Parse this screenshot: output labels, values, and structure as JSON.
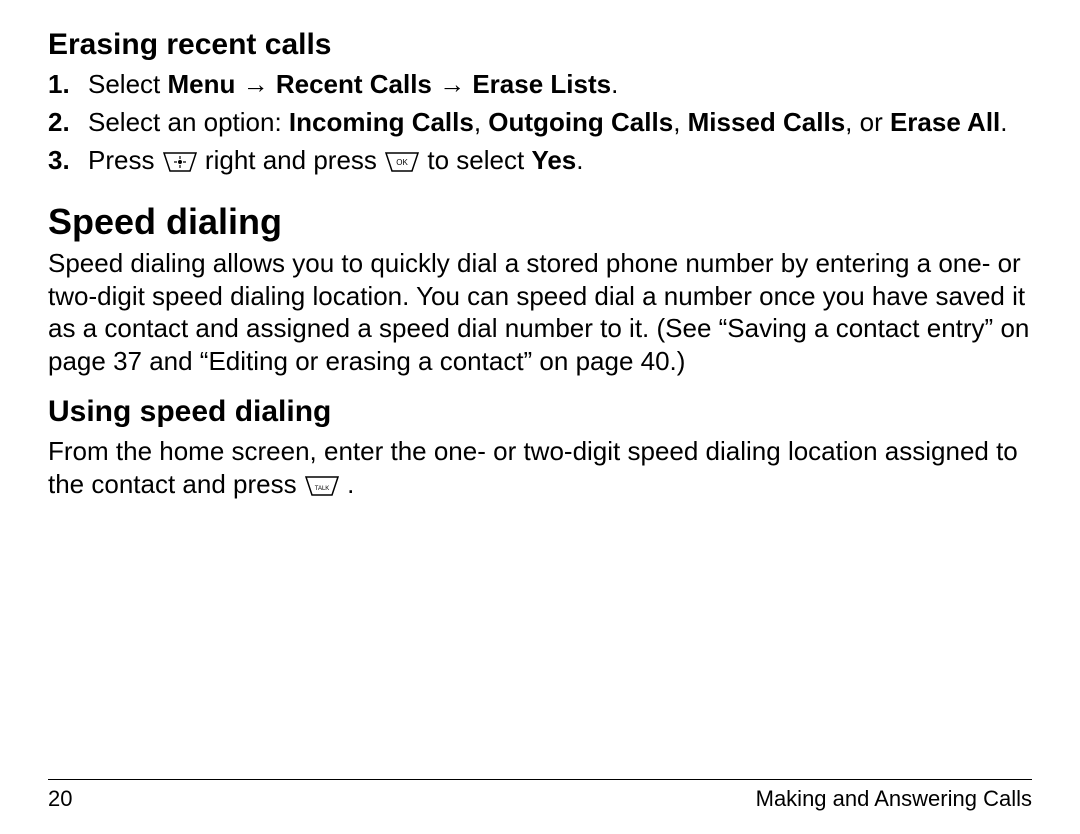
{
  "sections": {
    "erasing_heading": "Erasing recent calls",
    "step1": {
      "prefix": "Select ",
      "bold": "Menu → Recent Calls → Erase Lists",
      "suffix": "."
    },
    "step2": {
      "prefix": "Select an option: ",
      "b1": "Incoming Calls",
      "sep1": ", ",
      "b2": "Outgoing Calls",
      "sep2": ", ",
      "b3": "Missed Calls",
      "sep3": ", or ",
      "b4": "Erase All",
      "suffix": "."
    },
    "step3": {
      "prefix": "Press ",
      "mid": " right and press ",
      "after": " to select ",
      "yes": "Yes",
      "suffix": "."
    },
    "speed_heading": "Speed dialing",
    "speed_body": "Speed dialing allows you to quickly dial a stored phone number by entering a one- or two-digit speed dialing location. You can speed dial a number once you have saved it as a contact and assigned a speed dial number to it. (See “Saving a contact entry” on page 37 and “Editing or erasing a contact” on page 40.)",
    "using_heading": "Using speed dialing",
    "using_body_pre": "From the home screen, enter the one- or two-digit speed dialing location assigned to the contact and press ",
    "using_body_post": "."
  },
  "footer": {
    "page": "20",
    "chapter": "Making and Answering Calls"
  },
  "icons": {
    "nav_key": "nav-key-icon",
    "ok_key": "ok-key-icon",
    "talk_key": "talk-key-icon"
  }
}
